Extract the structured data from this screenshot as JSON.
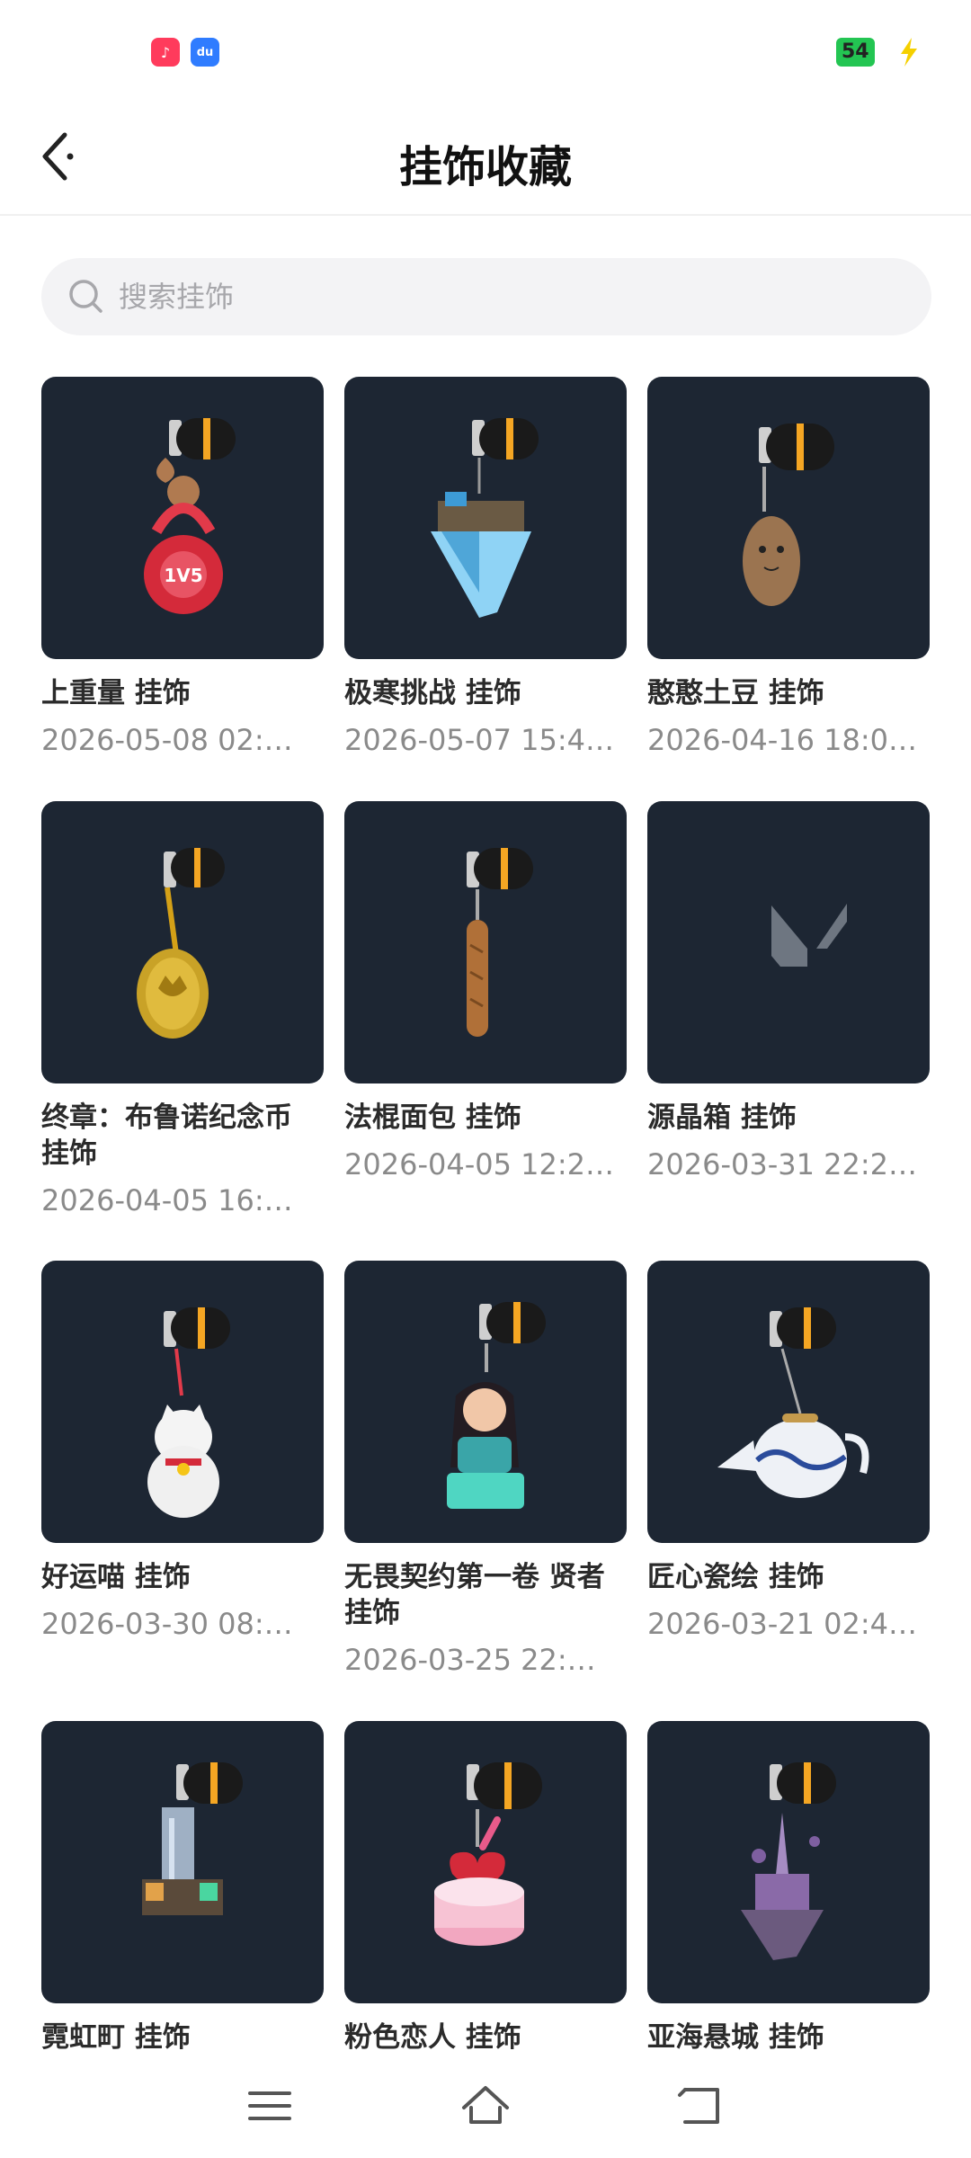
{
  "status_bar": {
    "battery_level": "54",
    "app_icon_1": "douyin-icon",
    "app_icon_2": "dewu-icon",
    "app_icon_2_text": "du"
  },
  "header": {
    "title": "挂饰收藏",
    "back_icon": "chevron-left-icon"
  },
  "search": {
    "placeholder": "搜索挂饰",
    "value": ""
  },
  "items": [
    {
      "title": "上重量 挂饰",
      "date": "2026-05-08 02:…",
      "icon": "kettlebell-charm-icon"
    },
    {
      "title": "极寒挑战 挂饰",
      "date": "2026-05-07 15:4…",
      "icon": "ice-island-charm-icon"
    },
    {
      "title": "憨憨土豆 挂饰",
      "date": "2026-04-16 18:0…",
      "icon": "potato-charm-icon"
    },
    {
      "title": "终章：布鲁诺纪念币 挂饰",
      "date": "2026-04-05 16:…",
      "icon": "coin-charm-icon"
    },
    {
      "title": "法棍面包 挂饰",
      "date": "2026-04-05 12:2…",
      "icon": "baguette-charm-icon"
    },
    {
      "title": "源晶箱 挂饰",
      "date": "2026-03-31 22:2…",
      "icon": "valorant-logo-icon"
    },
    {
      "title": "好运喵 挂饰",
      "date": "2026-03-30 08:…",
      "icon": "lucky-cat-charm-icon"
    },
    {
      "title": "无畏契约第一卷 贤者 挂饰",
      "date": "2026-03-25 22:…",
      "icon": "sage-figure-charm-icon"
    },
    {
      "title": "匠心瓷绘 挂饰",
      "date": "2026-03-21 02:4…",
      "icon": "teapot-charm-icon"
    },
    {
      "title": "霓虹町 挂饰",
      "date": "",
      "icon": "neon-city-charm-icon"
    },
    {
      "title": "粉色恋人 挂饰",
      "date": "",
      "icon": "heart-cake-charm-icon"
    },
    {
      "title": "亚海悬城 挂饰",
      "date": "",
      "icon": "floating-castle-charm-icon"
    }
  ],
  "nav": {
    "menu_icon": "menu-icon",
    "home_icon": "home-icon",
    "back_icon": "back-arrow-icon"
  },
  "colors": {
    "card_background": "#1d2633",
    "title_text": "#2b2b2b",
    "date_text": "#8a8a8a",
    "search_background": "#f3f3f5",
    "accent_orange": "#f5a623",
    "battery_green": "#23c552"
  }
}
